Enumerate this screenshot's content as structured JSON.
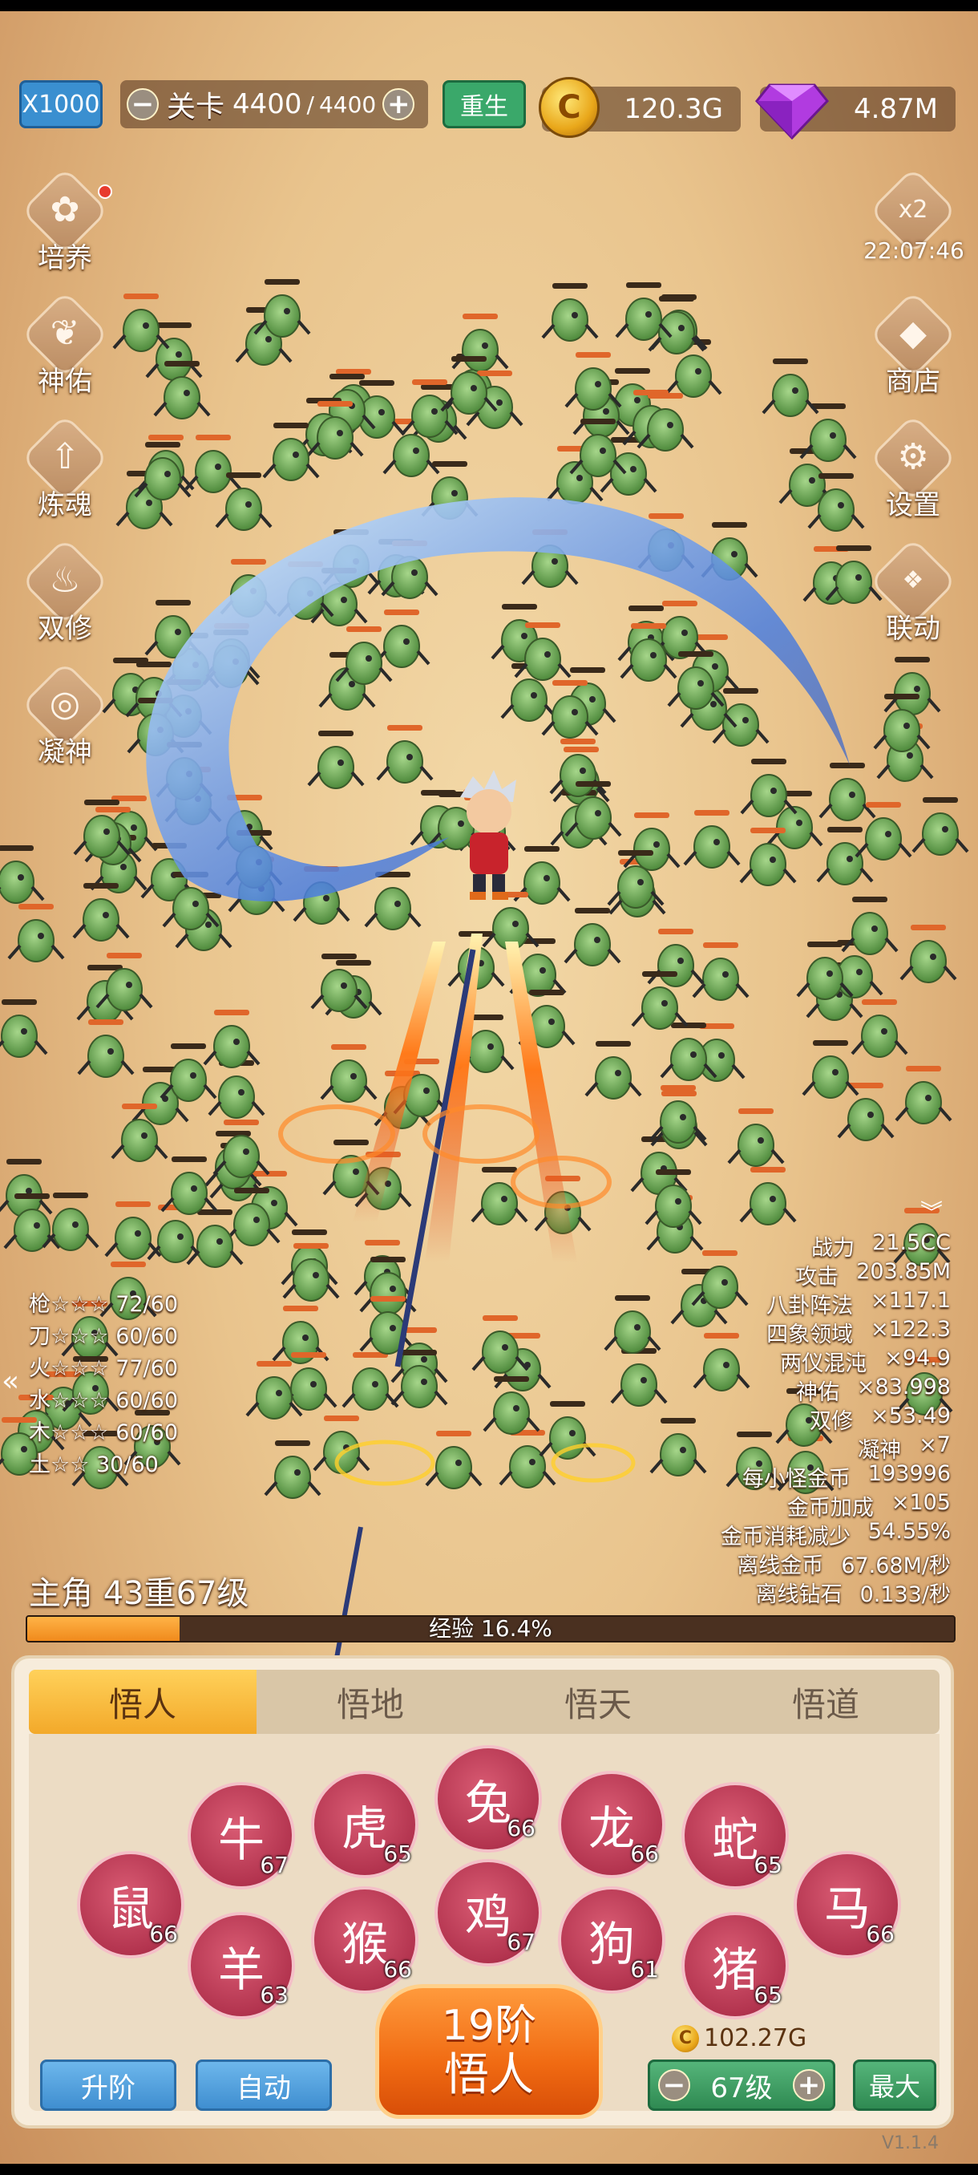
{
  "hud": {
    "speed": "X1000",
    "stage_label": "关卡",
    "stage_current": "4400",
    "stage_sep": "/",
    "stage_max": "4400",
    "minus": "−",
    "plus": "+",
    "rebirth": "重生",
    "gold_symbol": "C",
    "gold": "120.3G",
    "gems": "4.87M"
  },
  "left_menu": [
    "培养",
    "神佑",
    "炼魂",
    "双修",
    "凝神"
  ],
  "right_menu": {
    "boost": "x2",
    "timer": "22:07:46",
    "shop": "商店",
    "settings": "设置",
    "link": "联动"
  },
  "elements": [
    {
      "text": "枪☆☆☆ 72/60"
    },
    {
      "text": "刀☆☆☆ 60/60"
    },
    {
      "text": "火☆☆☆ 77/60"
    },
    {
      "text": "水☆☆☆ 60/60"
    },
    {
      "text": "木☆☆☆ 60/60"
    },
    {
      "text": "土☆☆ 30/60"
    }
  ],
  "stats": [
    {
      "label": "战力",
      "value": "21.5CC"
    },
    {
      "label": "攻击",
      "value": "203.85M"
    },
    {
      "label": "八卦阵法",
      "value": "×117.1"
    },
    {
      "label": "四象领域",
      "value": "×122.3"
    },
    {
      "label": "两仪混沌",
      "value": "×94.9"
    },
    {
      "label": "神佑",
      "value": "×83.998"
    },
    {
      "label": "双修",
      "value": "×53.49"
    },
    {
      "label": "凝神",
      "value": "×7"
    },
    {
      "label": "每小怪金币",
      "value": "193996"
    },
    {
      "label": "金币加成",
      "value": "×105"
    },
    {
      "label": "金币消耗减少",
      "value": "54.55%"
    },
    {
      "label": "离线金币",
      "value": "67.68M/秒"
    },
    {
      "label": "离线钻石",
      "value": "0.133/秒"
    }
  ],
  "hero": {
    "name": "主角  43重67级",
    "xp_text": "经验 16.4%",
    "xp_progress": 0.164
  },
  "tabs": [
    "悟人",
    "悟地",
    "悟天",
    "悟道"
  ],
  "zodiac": [
    {
      "icon": "rat-icon",
      "glyph": "鼠",
      "level": "66"
    },
    {
      "icon": "ox-icon",
      "glyph": "牛",
      "level": "67"
    },
    {
      "icon": "tiger-icon",
      "glyph": "虎",
      "level": "65"
    },
    {
      "icon": "rabbit-icon",
      "glyph": "兔",
      "level": "66"
    },
    {
      "icon": "dragon-icon",
      "glyph": "龙",
      "level": "66"
    },
    {
      "icon": "snake-icon",
      "glyph": "蛇",
      "level": "65"
    },
    {
      "icon": "horse-icon",
      "glyph": "马",
      "level": "66"
    },
    {
      "icon": "goat-icon",
      "glyph": "羊",
      "level": "63"
    },
    {
      "icon": "monkey-icon",
      "glyph": "猴",
      "level": "66"
    },
    {
      "icon": "rooster-icon",
      "glyph": "鸡",
      "level": "67"
    },
    {
      "icon": "dog-icon",
      "glyph": "狗",
      "level": "61"
    },
    {
      "icon": "pig-icon",
      "glyph": "猪",
      "level": "65"
    }
  ],
  "actions": {
    "upgrade": "升阶",
    "auto": "自动",
    "breakthrough_tier": "19阶",
    "breakthrough_name": "悟人",
    "cost": "102.27G",
    "level": "67级",
    "max": "最大"
  },
  "version": "V1.1.4",
  "colors": {
    "accent_orange": "#f06a12",
    "tab_active": "#f3a92a",
    "zodiac_red": "#b3344f",
    "button_blue": "#3f8ed0",
    "button_green": "#2f8a52"
  }
}
